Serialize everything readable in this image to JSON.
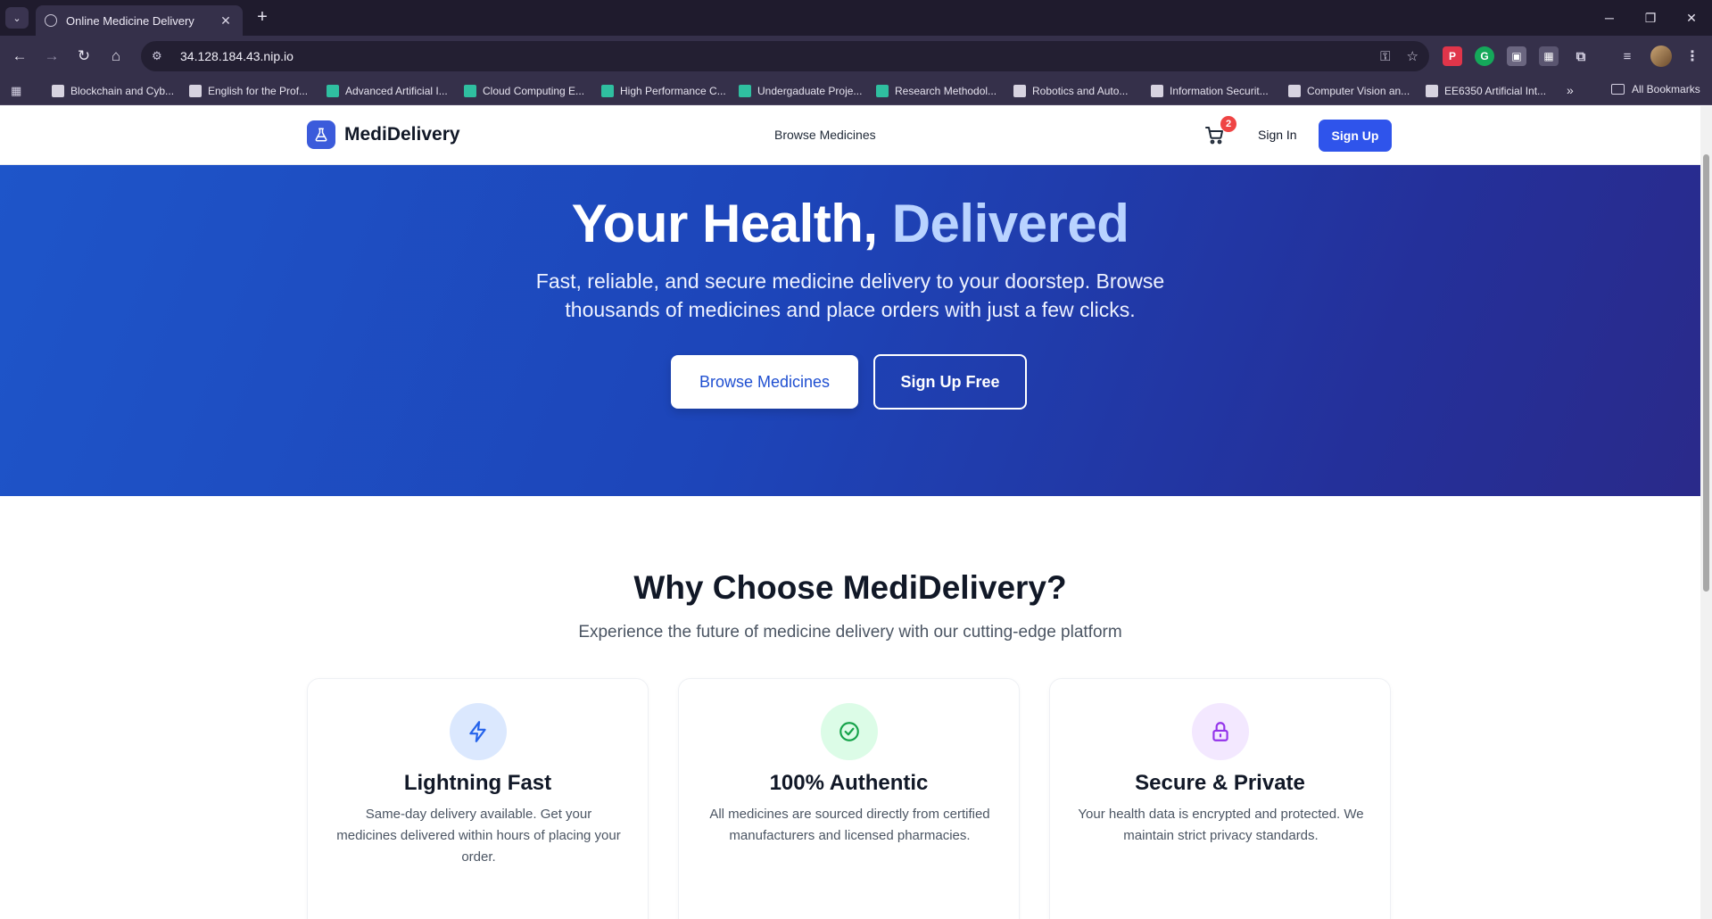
{
  "browser": {
    "tab_title": "Online Medicine Delivery",
    "url": "34.128.184.43.nip.io",
    "bookmarks": [
      "Blockchain and Cyb...",
      "English for the Prof...",
      "Advanced Artificial I...",
      "Cloud Computing E...",
      "High Performance C...",
      "Undergaduate Proje...",
      "Research Methodol...",
      "Robotics and Auto...",
      "Information Securit...",
      "Computer Vision an...",
      "EE6350 Artificial Int..."
    ],
    "all_bookmarks": "All Bookmarks"
  },
  "nav": {
    "brand": "MediDelivery",
    "browse_link": "Browse Medicines",
    "cart_count": "2",
    "sign_in": "Sign In",
    "sign_up": "Sign Up"
  },
  "hero": {
    "title_main": "Your Health, ",
    "title_accent": "Delivered",
    "subtitle": "Fast, reliable, and secure medicine delivery to your doorstep. Browse thousands of medicines and place orders with just a few clicks.",
    "primary_cta": "Browse Medicines",
    "secondary_cta": "Sign Up Free"
  },
  "features": {
    "title": "Why Choose MediDelivery?",
    "subtitle": "Experience the future of medicine delivery with our cutting-edge platform",
    "cards": [
      {
        "icon": "lightning-icon",
        "title": "Lightning Fast",
        "description": "Same-day delivery available. Get your medicines delivered within hours of placing your order."
      },
      {
        "icon": "check-circle-icon",
        "title": "100% Authentic",
        "description": "All medicines are sourced directly from certified manufacturers and licensed pharmacies."
      },
      {
        "icon": "lock-icon",
        "title": "Secure & Private",
        "description": "Your health data is encrypted and protected. We maintain strict privacy standards."
      }
    ]
  },
  "colors": {
    "brand_blue": "#2f54eb",
    "hero_start": "#1e55c9",
    "hero_end": "#2a2a8a",
    "accent_text": "#b9d3ff",
    "badge_red": "#ef4444"
  }
}
